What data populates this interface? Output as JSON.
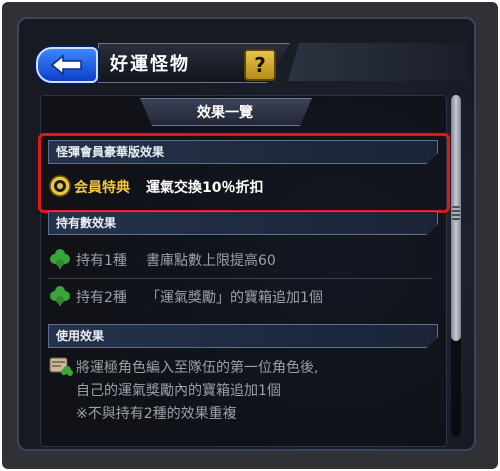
{
  "header": {
    "title": "好運怪物",
    "help_label": "?"
  },
  "effects_list": {
    "title": "效果一覽",
    "premium": {
      "category": "怪彈會員豪華版效果",
      "badge": "会員特典",
      "text": "運氣交換10％折扣"
    },
    "possession": {
      "category": "持有數效果",
      "rows": [
        {
          "label": "持有1種",
          "text": "書庫點數上限提高60"
        },
        {
          "label": "持有2種",
          "text": "「運氣獎勵」的寶箱追加1個"
        }
      ]
    },
    "usage": {
      "category": "使用效果",
      "lines": [
        "將運極角色編入至隊伍的第一位角色後,",
        "自己的運氣獎勵內的寶箱追加1個",
        "※不與持有2種的效果重複"
      ]
    }
  },
  "colors": {
    "highlight": "#e01818",
    "accent_gold": "#e8c44a",
    "clover_green": "#3aa63a",
    "back_blue": "#1f5ee8"
  }
}
